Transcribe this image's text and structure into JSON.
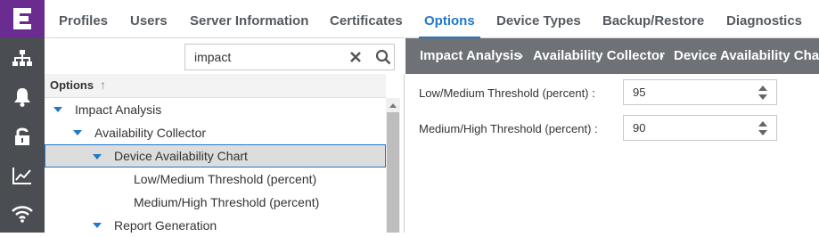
{
  "nav_rail": {
    "logo_icon": "extreme-logo-icon",
    "items": [
      {
        "name": "network-topology-icon"
      },
      {
        "name": "alarms-bell-icon"
      },
      {
        "name": "security-lock-icon"
      },
      {
        "name": "analytics-chart-icon"
      },
      {
        "name": "wireless-icon"
      }
    ]
  },
  "tabs": [
    {
      "label": "Profiles"
    },
    {
      "label": "Users"
    },
    {
      "label": "Server Information"
    },
    {
      "label": "Certificates"
    },
    {
      "label": "Options",
      "active": true
    },
    {
      "label": "Device Types"
    },
    {
      "label": "Backup/Restore"
    },
    {
      "label": "Diagnostics"
    }
  ],
  "search": {
    "value": "impact",
    "clear_icon": "clear-x-icon",
    "search_icon": "search-icon"
  },
  "tree": {
    "header": "Options",
    "sort_indicator": "↑",
    "items": [
      {
        "label": "Impact Analysis",
        "level": 0,
        "expanded": true
      },
      {
        "label": "Availability Collector",
        "level": 1,
        "expanded": true
      },
      {
        "label": "Device Availability Chart",
        "level": 2,
        "expanded": true,
        "selected": true
      },
      {
        "label": "Low/Medium Threshold (percent)",
        "level": 3
      },
      {
        "label": "Medium/High Threshold (percent)",
        "level": 3
      },
      {
        "label": "Report Generation",
        "level": 2,
        "expanded": true
      }
    ]
  },
  "breadcrumb": {
    "items": [
      "Impact Analysis",
      "Availability Collector",
      "Device Availability Chart"
    ],
    "separator": "›"
  },
  "settings": [
    {
      "label": "Low/Medium Threshold (percent) :",
      "value": "95"
    },
    {
      "label": "Medium/High Threshold (percent) :",
      "value": "90"
    }
  ],
  "colors": {
    "accent": "#1f78c8",
    "rail": "#4a4d52",
    "logo_bg": "#6a2c91",
    "breadcrumb_bg": "#6e7276"
  }
}
